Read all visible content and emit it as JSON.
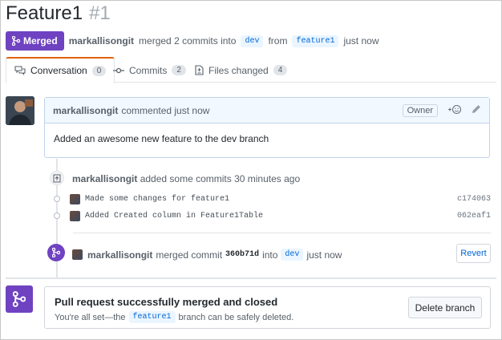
{
  "pr": {
    "title": "Feature1",
    "number": "#1",
    "state_label": "Merged",
    "author": "markallisongit",
    "merged_text": "merged 2 commits into",
    "base_branch": "dev",
    "from_text": "from",
    "head_branch": "feature1",
    "time": "just now"
  },
  "tabs": [
    {
      "label": "Conversation",
      "count": "0",
      "icon": "comment-discussion-icon"
    },
    {
      "label": "Commits",
      "count": "2",
      "icon": "git-commit-icon"
    },
    {
      "label": "Files changed",
      "count": "4",
      "icon": "file-diff-icon"
    }
  ],
  "comment": {
    "author": "markallisongit",
    "action": "commented just now",
    "badge": "Owner",
    "body": "Added an awesome new feature to the dev branch"
  },
  "commits_event": {
    "author": "markallisongit",
    "text": "added some commits 30 minutes ago",
    "commits": [
      {
        "message": "Made some changes for feature1",
        "sha": "c174063"
      },
      {
        "message": "Added Created column in Feature1Table",
        "sha": "062eaf1"
      }
    ]
  },
  "merge_event": {
    "author": "markallisongit",
    "text": "merged commit",
    "sha": "360b71d",
    "into": "into",
    "branch": "dev",
    "time": "just now",
    "revert_label": "Revert"
  },
  "merged_box": {
    "title": "Pull request successfully merged and closed",
    "sub_pre": "You're all set—the",
    "branch": "feature1",
    "sub_post": "branch can be safely deleted.",
    "delete_label": "Delete branch"
  },
  "colors": {
    "merged": "#6f42c1",
    "link": "#0366d6",
    "active_tab": "#e36209"
  }
}
